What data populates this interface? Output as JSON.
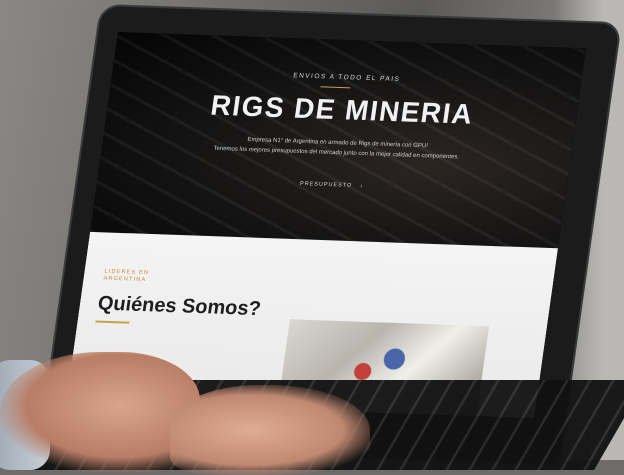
{
  "website": {
    "hero": {
      "top_line": "ENVIOS A TODO EL PAIS",
      "title": "RIGS DE MINERIA",
      "line1": "Empresa N1° de Argentina en armado de Rigs de minería con GPU!",
      "line2": "Tenemos los mejores presupuestos del mercado junto con la mejor calidad en componentes.",
      "cta": "PRESUPUESTO"
    },
    "section": {
      "tag": "LIDERES EN ARGENTINA",
      "heading": "Quiénes Somos?"
    }
  },
  "colors": {
    "accent": "#c9a24a",
    "hero_bg": "#111111"
  },
  "icons": {
    "cta_icon": "arrow-down-icon"
  }
}
